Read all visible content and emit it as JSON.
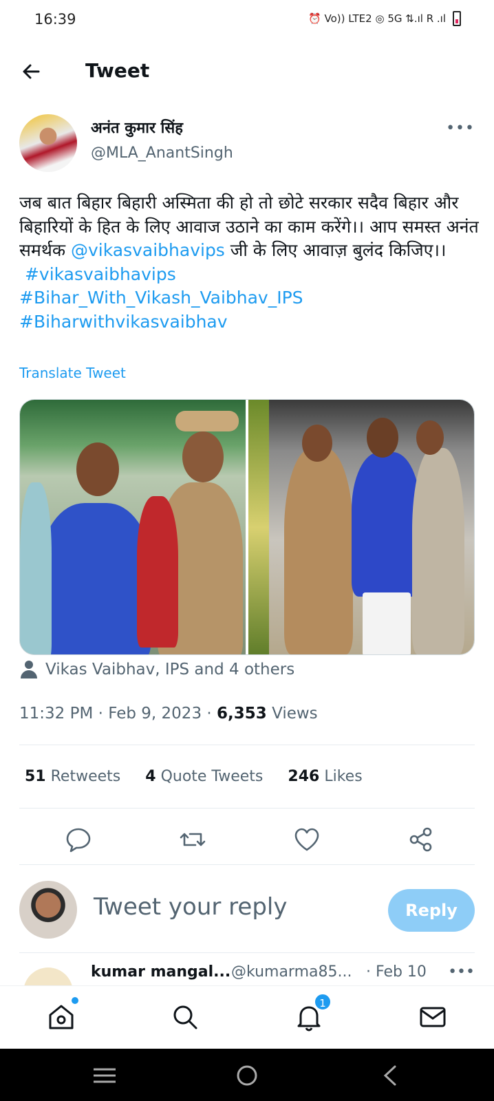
{
  "status_bar": {
    "time": "16:39",
    "indicators": "⏰  Vo)) LTE2  ◎ 5G ⇅.ıl   R .ıl"
  },
  "header": {
    "title": "Tweet"
  },
  "tweet": {
    "author": {
      "name": "अनंत कुमार सिंह",
      "handle": "@MLA_AnantSingh"
    },
    "text_part1": "जब बात बिहार बिहारी अस्मिता की हो तो छोटे सरकार सदैव बिहार और बिहारियों के हित के लिए आवाज उठाने का काम करेंगे।। आप समस्त अनंत समर्थक ",
    "mention": "@vikasvaibhavips",
    "text_part2": " जी के लिए आवाज़ बुलंद किजिए।।",
    "hashtags": [
      "#vikasvaibhavips",
      "#Bihar_With_Vikash_Vaibhav_IPS",
      "#Biharwithvikasvaibhav"
    ],
    "translate_label": "Translate Tweet",
    "liked_by": "Vikas Vaibhav, IPS and 4 others",
    "time": "11:32 PM",
    "date": "Feb 9, 2023",
    "views_count": "6,353",
    "views_label": "Views",
    "retweets_count": "51",
    "retweets_label": "Retweets",
    "quotes_count": "4",
    "quotes_label": "Quote Tweets",
    "likes_count": "246",
    "likes_label": "Likes"
  },
  "reply": {
    "placeholder": "Tweet your reply",
    "button_label": "Reply"
  },
  "next_reply": {
    "name": "kumar mangal...",
    "handle": "@kumarma85...",
    "date": "· Feb 10"
  },
  "bottom_nav": {
    "notifications_badge": "1"
  },
  "colors": {
    "accent": "#1d9bf0",
    "reply_button": "#8ecdf7",
    "secondary_text": "#536471"
  }
}
